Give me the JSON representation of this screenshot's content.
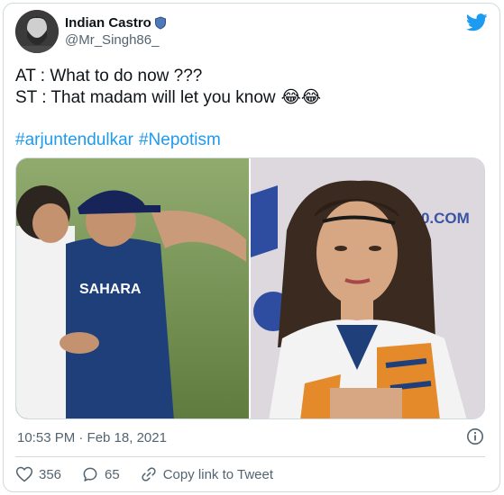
{
  "author": {
    "display_name": "Indian Castro",
    "handle": "@Mr_Singh86_"
  },
  "tweet": {
    "lines": [
      "AT : What to do now ???",
      "ST : That madam will let you know"
    ],
    "line2_emojis": "😂😂",
    "hashtags": [
      "#arjuntendulkar",
      "#Nepotism"
    ]
  },
  "media": {
    "left_jersey_text": "SAHARA",
    "right_backdrop_text": "LT20.COM"
  },
  "meta": {
    "timestamp": "10:53 PM · Feb 18, 2021"
  },
  "actions": {
    "like_count": "356",
    "reply_count": "65",
    "copy_link_label": "Copy link to Tweet"
  },
  "colors": {
    "accent": "#1d9bf0",
    "like_heart": "#536471",
    "text_secondary": "#536471"
  }
}
